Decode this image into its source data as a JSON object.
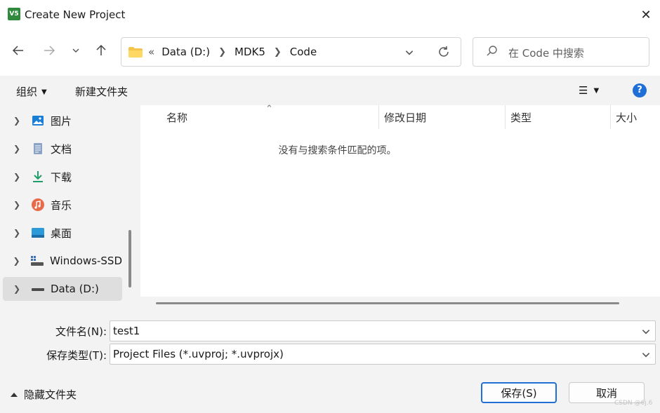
{
  "window": {
    "title": "Create New Project",
    "app_icon": "keil-uvision-icon",
    "close_label": "✕"
  },
  "nav": {
    "back_icon": "arrow-left-icon",
    "forward_icon": "arrow-right-icon",
    "recent_icon": "chevron-down-icon",
    "up_icon": "arrow-up-icon",
    "address": {
      "overflow": "«",
      "crumbs": [
        "Data (D:)",
        "MDK5",
        "Code"
      ]
    },
    "search_placeholder": "在 Code 中搜索"
  },
  "toolbar": {
    "organize": "组织",
    "new_folder": "新建文件夹",
    "help": "?"
  },
  "sidebar": {
    "items": [
      {
        "label": "图片",
        "icon": "pictures-icon"
      },
      {
        "label": "文档",
        "icon": "documents-icon"
      },
      {
        "label": "下载",
        "icon": "downloads-icon"
      },
      {
        "label": "音乐",
        "icon": "music-icon"
      },
      {
        "label": "桌面",
        "icon": "desktop-icon"
      },
      {
        "label": "Windows-SSD",
        "icon": "windows-drive-icon"
      },
      {
        "label": "Data (D:)",
        "icon": "drive-icon",
        "selected": true
      }
    ]
  },
  "files": {
    "columns": [
      "名称",
      "修改日期",
      "类型",
      "大小"
    ],
    "empty_message": "没有与搜索条件匹配的项。"
  },
  "form": {
    "filename_label": "文件名(N):",
    "filename_value": "test1",
    "filetype_label": "保存类型(T):",
    "filetype_value": "Project Files (*.uvproj; *.uvprojx)"
  },
  "footer": {
    "hide_folders": "隐藏文件夹",
    "save": "保存(S)",
    "cancel": "取消",
    "watermark": "CSDN @6j.6"
  },
  "colors": {
    "accent": "#1f6fd6",
    "pane_bg": "#f3f3f3",
    "selected_bg": "#dedede"
  }
}
